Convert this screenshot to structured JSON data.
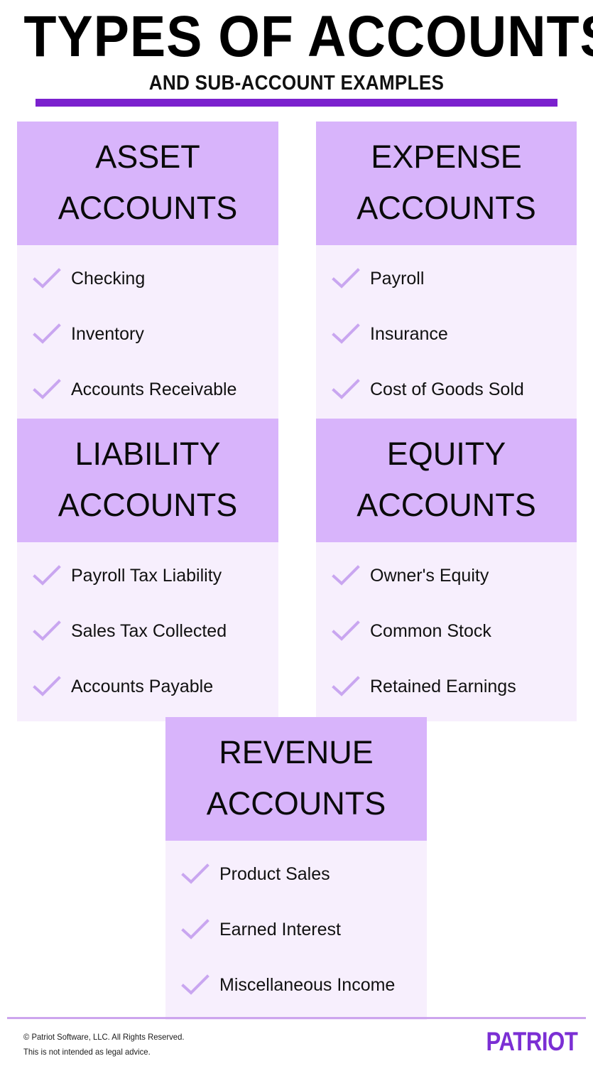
{
  "header": {
    "title": "TYPES OF ACCOUNTS",
    "subtitle": "AND SUB-ACCOUNT EXAMPLES",
    "accent_color": "#7B21CE"
  },
  "theme": {
    "card_header_bg": "#D8B4FB",
    "card_body_bg": "#F7EFFD",
    "check_color": "#C9A6F0",
    "brand_purple": "#7B2FD4",
    "text_color": "#111111",
    "page_bg": "#FFFFFF"
  },
  "cards": [
    {
      "title_line1": "ASSET",
      "title_line2": "ACCOUNTS",
      "items": [
        "Checking",
        "Inventory",
        "Accounts Receivable"
      ]
    },
    {
      "title_line1": "EXPENSE",
      "title_line2": "ACCOUNTS",
      "items": [
        "Payroll",
        "Insurance",
        "Cost of Goods Sold"
      ]
    },
    {
      "title_line1": "LIABILITY",
      "title_line2": "ACCOUNTS",
      "items": [
        "Payroll Tax Liability",
        "Sales Tax Collected",
        "Accounts Payable"
      ]
    },
    {
      "title_line1": "EQUITY",
      "title_line2": "ACCOUNTS",
      "items": [
        "Owner's Equity",
        "Common Stock",
        "Retained Earnings"
      ]
    },
    {
      "title_line1": "REVENUE",
      "title_line2": "ACCOUNTS",
      "items": [
        "Product Sales",
        "Earned Interest",
        "Miscellaneous Income"
      ]
    }
  ],
  "footer": {
    "copyright": "© Patriot Software, LLC. All Rights Reserved.",
    "disclaimer": "This is not intended as legal advice.",
    "logo": "PATRIOT"
  }
}
